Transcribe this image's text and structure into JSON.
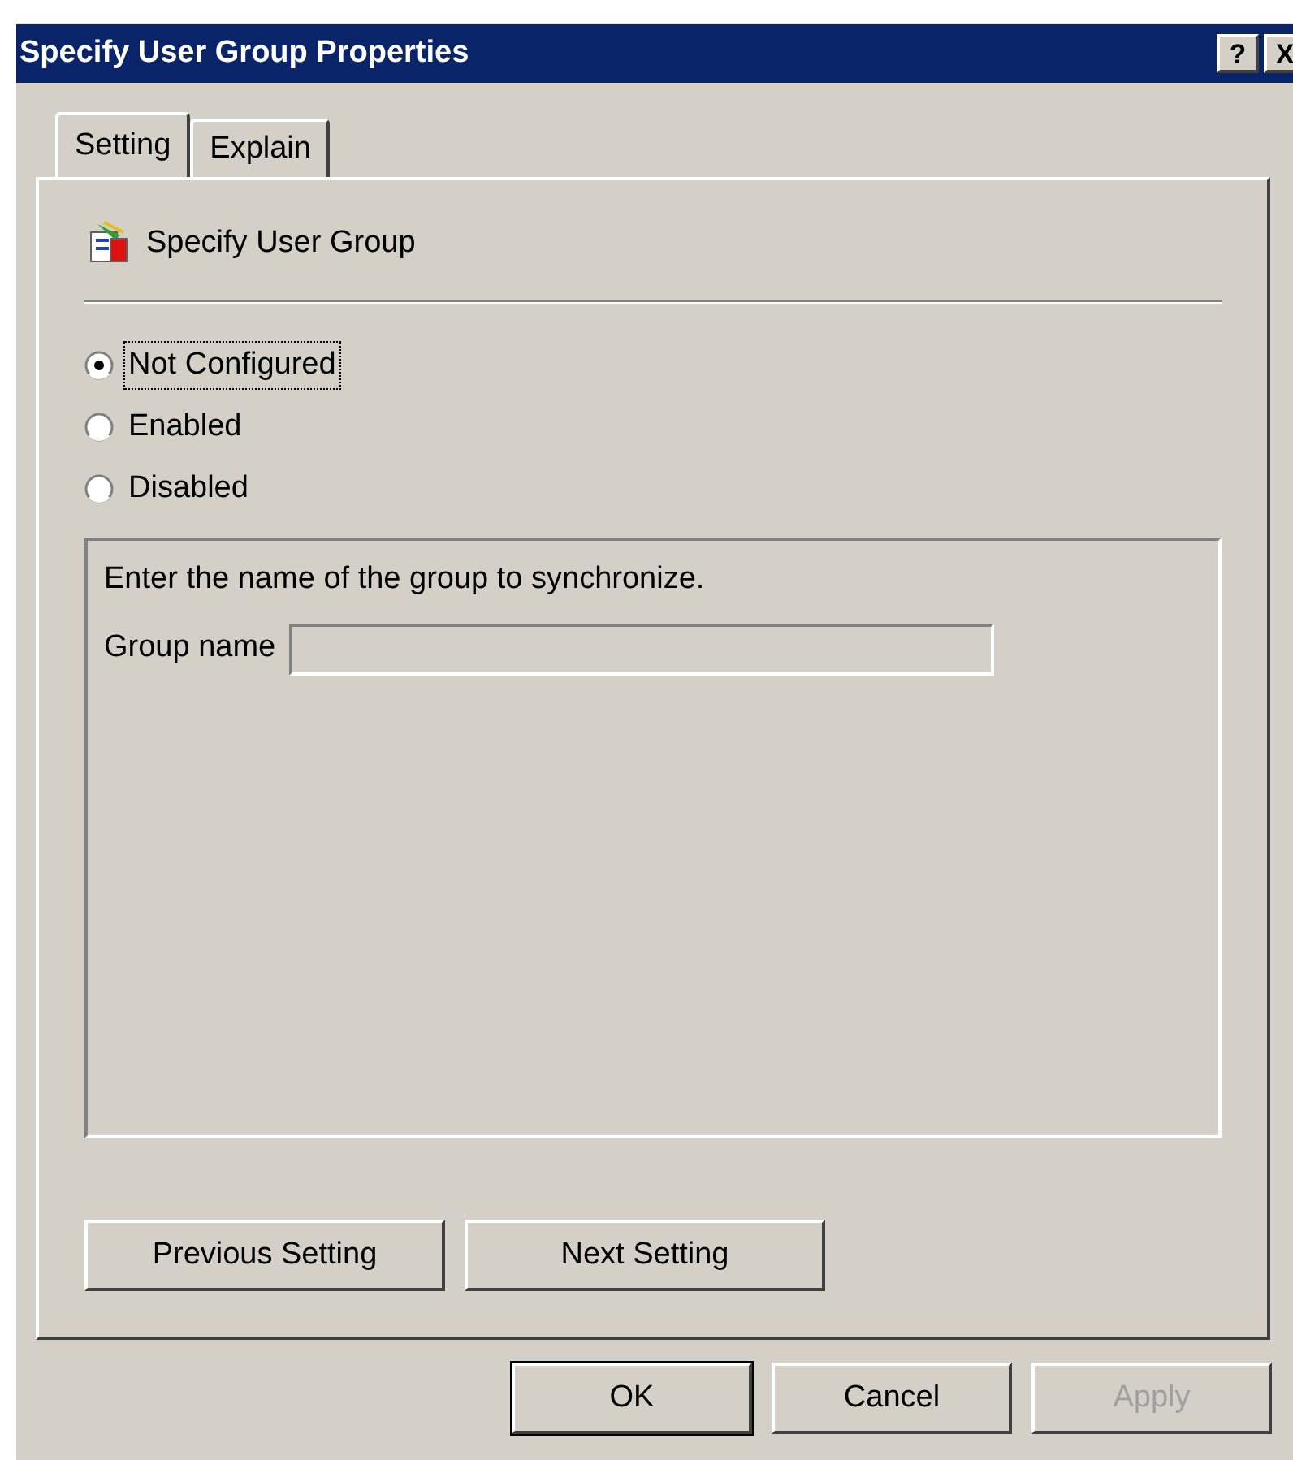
{
  "window": {
    "title": "Specify User Group Properties",
    "title_buttons": [
      "?",
      "X"
    ]
  },
  "tabs": [
    {
      "label": "Setting",
      "selected": true
    },
    {
      "label": "Explain",
      "selected": false
    }
  ],
  "setting": {
    "name": "Specify User Group"
  },
  "options": [
    {
      "label": "Not Configured",
      "selected": true,
      "focused": true
    },
    {
      "label": "Enabled",
      "selected": false,
      "focused": false
    },
    {
      "label": "Disabled",
      "selected": false,
      "focused": false
    }
  ],
  "options_panel": {
    "description": "Enter the name of the group to synchronize.",
    "field_label": "Group name",
    "field_disabled": true
  },
  "nav_buttons": [
    "Previous Setting",
    "Next Setting"
  ],
  "buttons": [
    {
      "label": "OK",
      "default": true,
      "disabled": false
    },
    {
      "label": "Cancel",
      "default": false,
      "disabled": false
    },
    {
      "label": "Apply",
      "default": false,
      "disabled": true
    }
  ]
}
